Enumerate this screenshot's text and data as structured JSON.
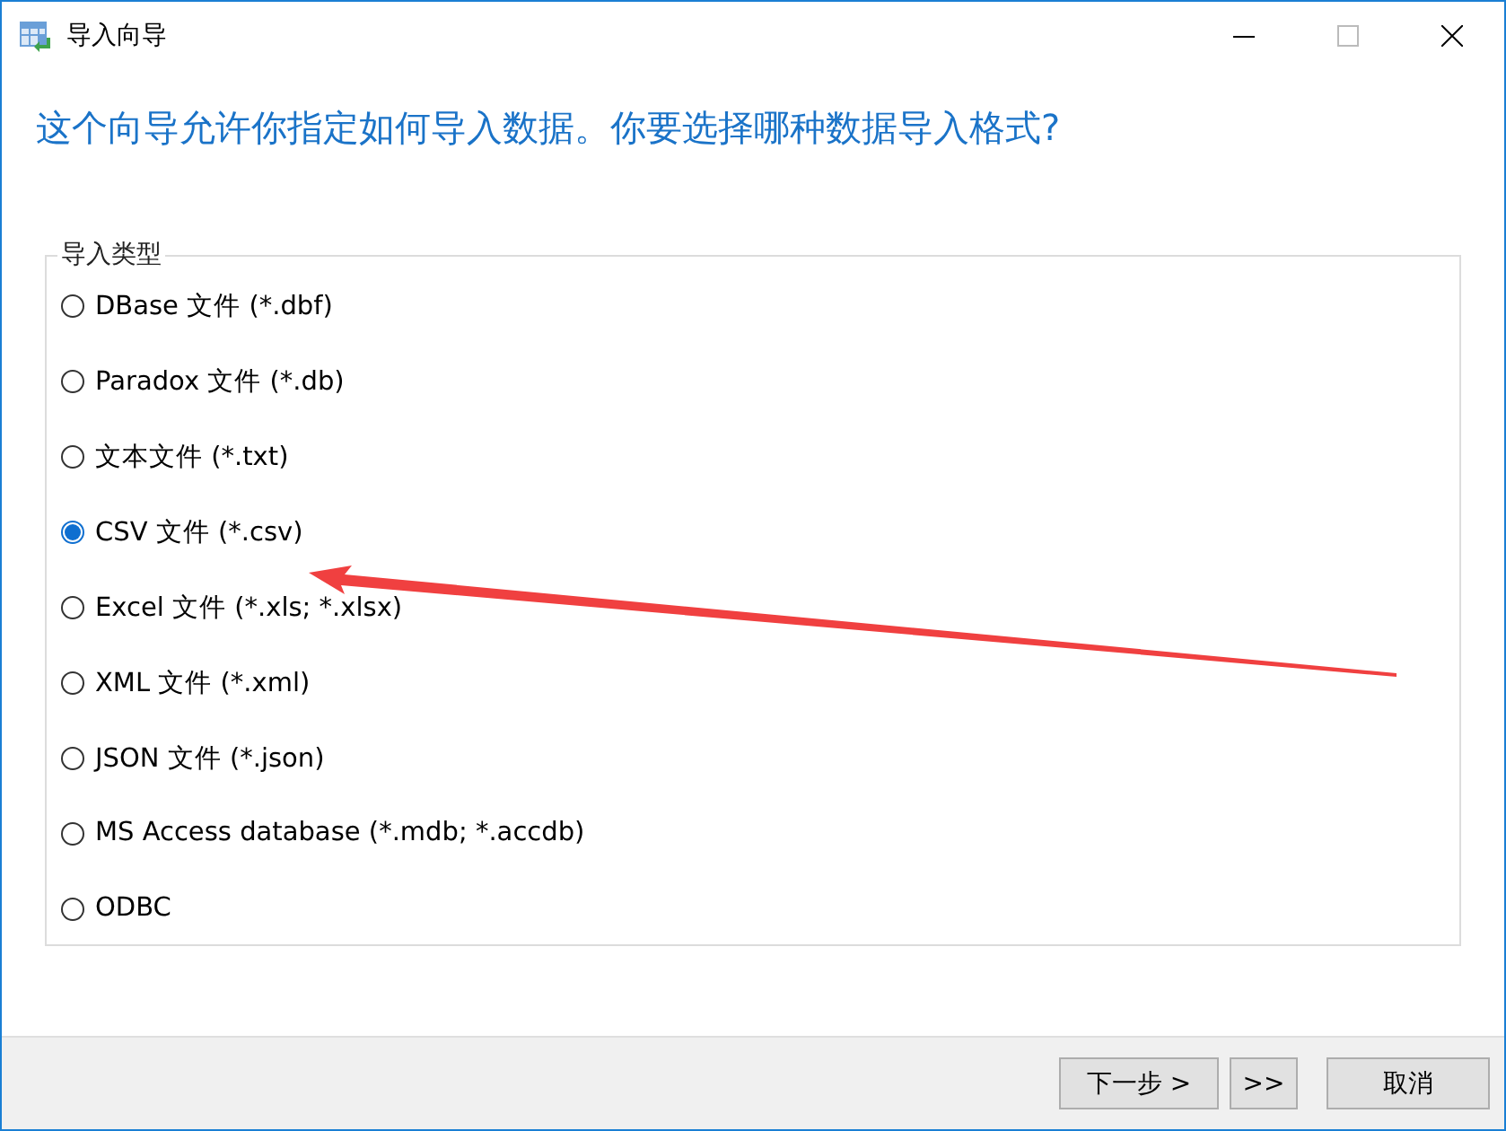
{
  "window": {
    "title": "导入向导"
  },
  "heading": "这个向导允许你指定如何导入数据。你要选择哪种数据导入格式?",
  "import_type": {
    "label": "导入类型",
    "options": [
      {
        "label": "DBase 文件 (*.dbf)",
        "selected": false
      },
      {
        "label": "Paradox 文件 (*.db)",
        "selected": false
      },
      {
        "label": "文本文件 (*.txt)",
        "selected": false
      },
      {
        "label": "CSV 文件 (*.csv)",
        "selected": true
      },
      {
        "label": "Excel 文件 (*.xls; *.xlsx)",
        "selected": false
      },
      {
        "label": "XML 文件 (*.xml)",
        "selected": false
      },
      {
        "label": "JSON 文件 (*.json)",
        "selected": false
      },
      {
        "label": "MS Access database (*.mdb; *.accdb)",
        "selected": false
      },
      {
        "label": "ODBC",
        "selected": false
      }
    ]
  },
  "buttons": [
    {
      "label": "下一步 >",
      "kind": "next"
    },
    {
      "label": ">>",
      "kind": "last"
    },
    {
      "label": "取消",
      "kind": "cancel"
    }
  ]
}
